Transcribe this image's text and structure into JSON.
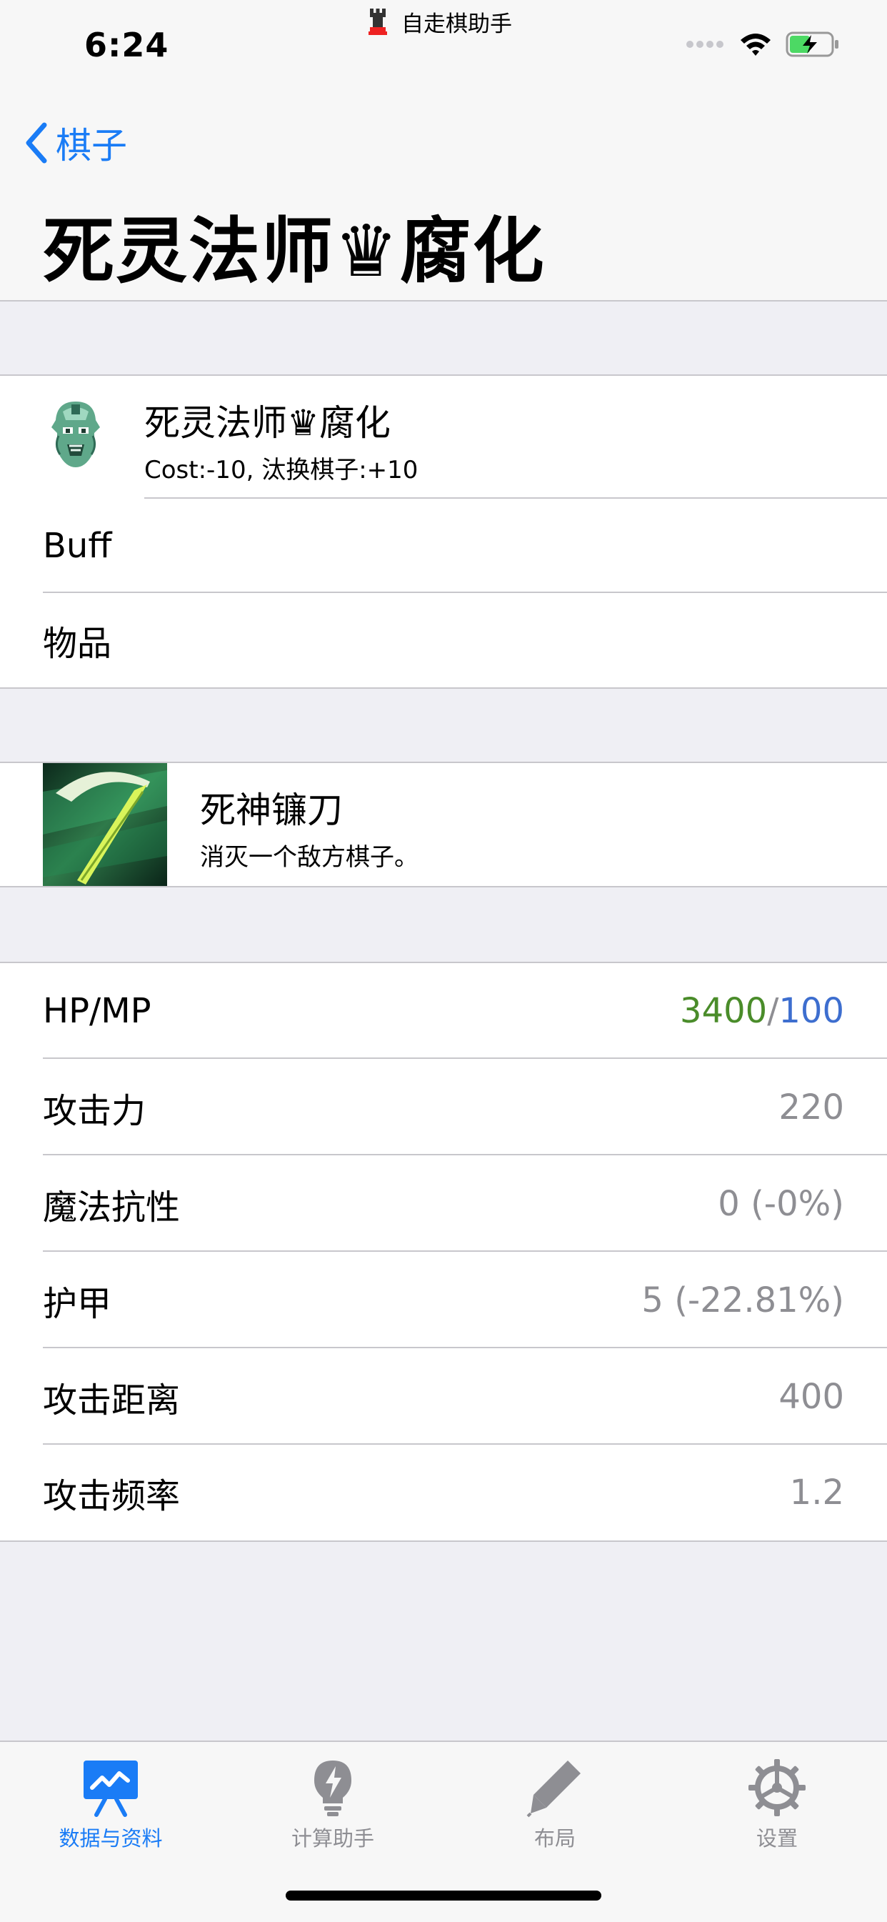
{
  "status": {
    "time": "6:24",
    "back_app": "自走棋助手"
  },
  "nav": {
    "back_label": "棋子",
    "title": "死灵法师♛腐化"
  },
  "piece": {
    "name": "死灵法师♛腐化",
    "detail": "Cost:-10, 汰换棋子:+10"
  },
  "rows": {
    "buff": "Buff",
    "items": "物品"
  },
  "skill": {
    "name": "死神镰刀",
    "description": "消灭一个敌方棋子。"
  },
  "stats": {
    "hpmp_label": "HP/MP",
    "hp": "3400",
    "slash": "/",
    "mp": "100",
    "attack_label": "攻击力",
    "attack_value": "220",
    "magic_res_label": "魔法抗性",
    "magic_res_value": "0 (-0%)",
    "armor_label": "护甲",
    "armor_value": "5 (-22.81%)",
    "range_label": "攻击距离",
    "range_value": "400",
    "speed_label": "攻击频率",
    "speed_value": "1.2"
  },
  "tabs": [
    {
      "label": "数据与资料",
      "icon": "chart-board-icon"
    },
    {
      "label": "计算助手",
      "icon": "lightbulb-bolt-icon"
    },
    {
      "label": "布局",
      "icon": "pen-icon"
    },
    {
      "label": "设置",
      "icon": "gear-icon"
    }
  ],
  "colors": {
    "accent": "#1a7cf6",
    "hp": "#4a8c2a",
    "mp": "#3d6ecf",
    "secondary": "#8e8e93"
  }
}
